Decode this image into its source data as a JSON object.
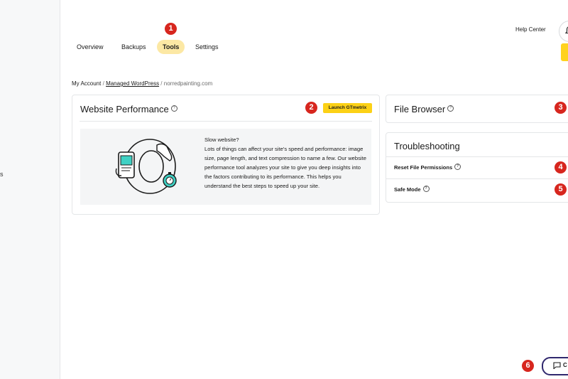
{
  "sidebar": {
    "fragment": "s"
  },
  "tabs": [
    {
      "label": "Overview"
    },
    {
      "label": "Backups"
    },
    {
      "label": "Tools"
    },
    {
      "label": "Settings"
    }
  ],
  "header": {
    "help_label": "Help Center"
  },
  "breadcrumb": {
    "items": [
      "My Account",
      "Managed WordPress",
      "norredpainting.com"
    ],
    "separator": "/"
  },
  "performance": {
    "title": "Website Performance",
    "button_label": "Launch GTmetrix",
    "heading": "Slow website?",
    "body": "Lots of things can affect your site's speed and performance: image size, page length, and text compression to name a few. Our website performance tool analyzes your site to give you deep insights into the factors contributing to its performance. This helps you understand the best steps to speed up your site."
  },
  "file_browser": {
    "title": "File Browser"
  },
  "troubleshooting": {
    "title": "Troubleshooting",
    "items": [
      {
        "label": "Reset File Permissions"
      },
      {
        "label": "Safe Mode"
      }
    ]
  },
  "badges": [
    "1",
    "2",
    "3",
    "4",
    "5",
    "6"
  ],
  "chat": {
    "label": "C"
  },
  "colors": {
    "accent_yellow": "#fcd116",
    "active_tab": "#fce8a4",
    "badge_red": "#d7261e",
    "chat_border": "#30286e",
    "illustration_teal": "#3fd1c4"
  },
  "icons": [
    "info-icon",
    "bell-icon",
    "chat-icon",
    "phone-icon",
    "stopwatch-icon",
    "hand-icon"
  ]
}
